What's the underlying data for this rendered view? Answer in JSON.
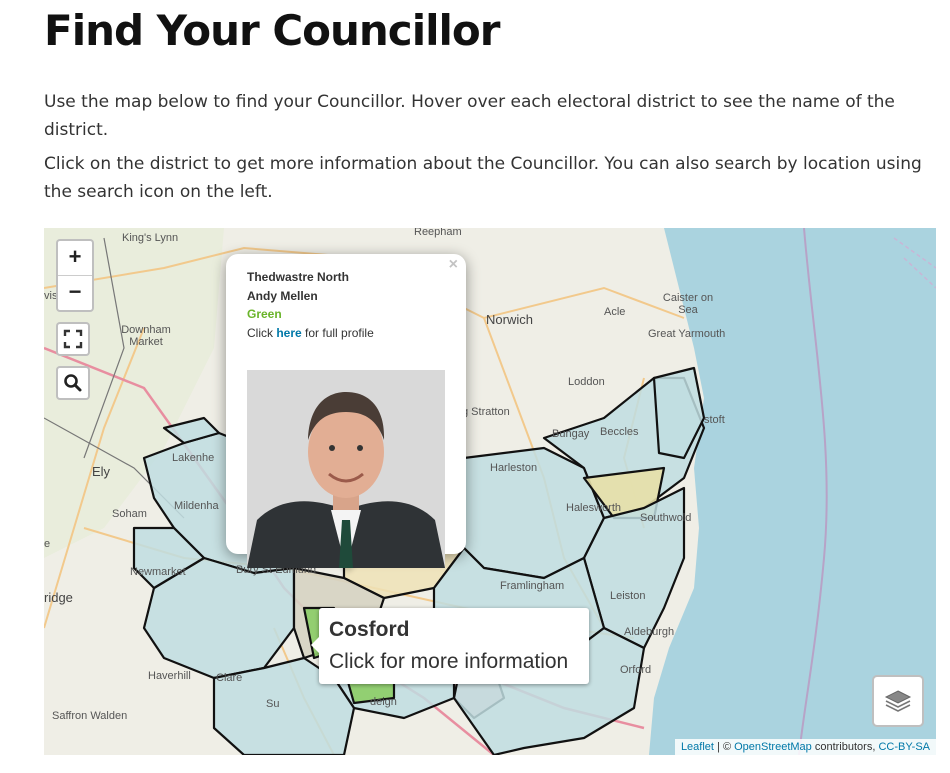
{
  "page": {
    "title": "Find Your Councillor",
    "paragraph1": "Use the map below to find your Councillor. Hover over each electoral district to see the name of the district.",
    "paragraph2": "Click on the district to get more information about the Councillor. You can also search by location using the search icon on the left."
  },
  "map": {
    "controls": {
      "zoom_in": "+",
      "zoom_out": "−",
      "fullscreen_icon": "fullscreen-icon",
      "search_icon": "search-icon",
      "layers_icon": "layers-icon"
    },
    "popup": {
      "district": "Thedwastre North",
      "councillor": "Andy Mellen",
      "party": "Green",
      "click_prefix": "Click",
      "click_link": "here",
      "click_suffix": "for full profile",
      "close": "×"
    },
    "tooltip": {
      "district": "Cosford",
      "hint": "Click for more information"
    },
    "places": {
      "kings_lynn": "King's Lynn",
      "reepham": "Reepham",
      "downham": "Downham\nMarket",
      "norwich": "Norwich",
      "acle": "Acle",
      "caister": "Caister on\nSea",
      "great_yarmouth": "Great Yarmouth",
      "loddon": "Loddon",
      "stratton": "g Stratton",
      "bungay": "Bungay",
      "beccles": "Beccles",
      "lowestoft": "stoft",
      "lakenheath": "Lakenhe",
      "ely": "Ely",
      "harleston": "Harleston",
      "mildenhall": "Mildenha",
      "soham": "Soham",
      "halesworth": "Halesworth",
      "southwold": "Southwold",
      "newmarket": "Newmarket",
      "bury": "Bury St Edmund",
      "framlingham": "Framlingham",
      "leiston": "Leiston",
      "aldeburgh": "Aldeburgh",
      "ridge": "ridge",
      "haverhill": "Haverhill",
      "clare": "Clare",
      "orford": "Orford",
      "saffron_walden": "Saffron Walden",
      "ipswich_frag": "deign",
      "left_frag1": "vis",
      "left_frag2": "e",
      "sudbury_frag": "Su"
    },
    "attribution": {
      "leaflet": "Leaflet",
      "separator": "| ©",
      "osm": "OpenStreetMap",
      "contributors": "contributors,",
      "license": "CC-BY-SA"
    }
  }
}
